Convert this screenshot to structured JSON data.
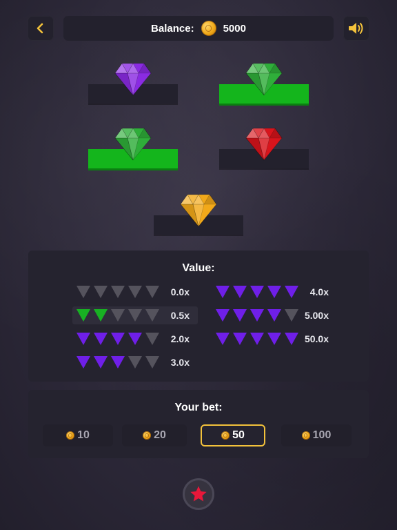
{
  "header": {
    "back_icon": "chevron-left-icon",
    "balance_label": "Balance:",
    "balance_value": "5000",
    "sound_icon": "speaker-icon"
  },
  "board": {
    "slots": [
      {
        "gem": "purple",
        "active": false
      },
      {
        "gem": "green",
        "active": true
      },
      {
        "gem": "green",
        "active": true
      },
      {
        "gem": "red",
        "active": false
      },
      {
        "gem": "gold",
        "active": false
      }
    ],
    "gem_colors": {
      "purple": "#8a2be2",
      "green": "#2fae3a",
      "red": "#d8141c",
      "gold": "#f2a91a"
    }
  },
  "value_panel": {
    "title": "Value:",
    "left_rows": [
      {
        "pattern": [
          "grey",
          "grey",
          "grey",
          "grey",
          "grey"
        ],
        "mult": "0.0x",
        "highlight": false
      },
      {
        "pattern": [
          "green",
          "green",
          "grey",
          "grey",
          "grey"
        ],
        "mult": "0.5x",
        "highlight": true
      },
      {
        "pattern": [
          "purple",
          "purple",
          "purple",
          "purple",
          "grey"
        ],
        "mult": "2.0x",
        "highlight": false
      },
      {
        "pattern": [
          "purple",
          "purple",
          "purple",
          "grey",
          "grey"
        ],
        "mult": "3.0x",
        "highlight": false
      }
    ],
    "right_rows": [
      {
        "pattern": [
          "purple",
          "purple",
          "purple",
          "purple",
          "purple"
        ],
        "mult": "4.0x",
        "highlight": false
      },
      {
        "pattern": [
          "purple",
          "purple",
          "purple",
          "purple",
          "grey"
        ],
        "mult": "5.00x",
        "highlight": false
      },
      {
        "pattern": [
          "purple",
          "purple",
          "purple",
          "purple",
          "purple"
        ],
        "mult": "50.0x",
        "highlight": false
      }
    ]
  },
  "bet_panel": {
    "title": "Your bet:",
    "options": [
      {
        "label": "10",
        "active": false
      },
      {
        "label": "20",
        "active": false
      },
      {
        "label": "50",
        "active": true
      },
      {
        "label": "100",
        "active": false
      }
    ],
    "active_color": "#f3c23b"
  },
  "play_button": {
    "icon": "star-icon",
    "color": "#e8183a"
  }
}
